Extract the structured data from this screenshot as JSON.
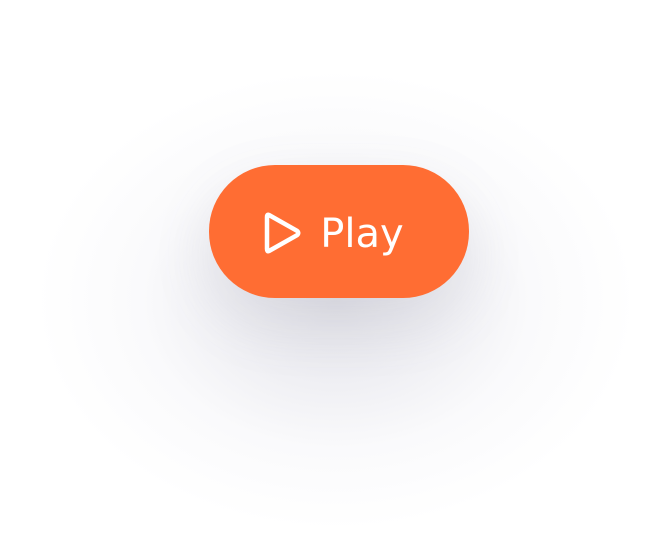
{
  "play_button": {
    "label": "Play",
    "icon": "play-icon",
    "color": "#FF6D33",
    "text_color": "#FFFFFF"
  }
}
